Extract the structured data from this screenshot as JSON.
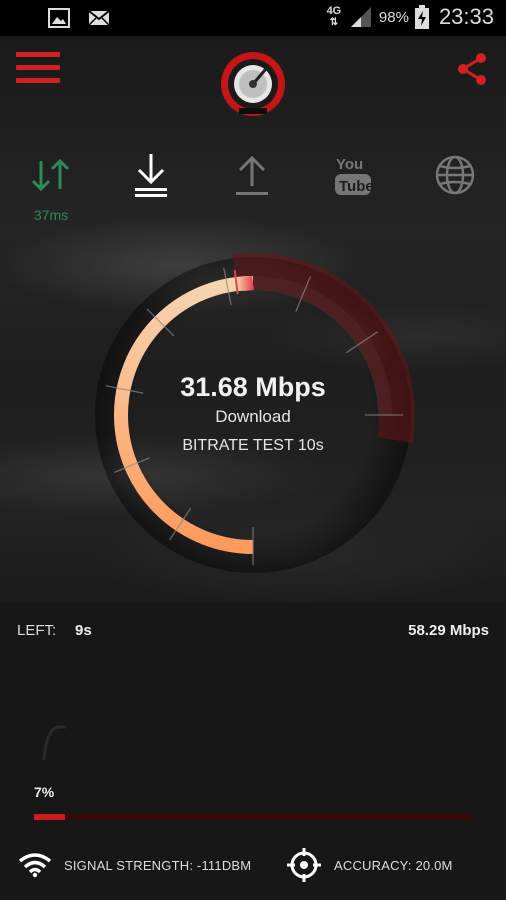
{
  "status_bar": {
    "network": "4G",
    "battery": "98%",
    "time": "23:33"
  },
  "tabs": [
    {
      "name": "ping",
      "icon": "ping-arrows-icon",
      "active": false,
      "color": "#2e8b57"
    },
    {
      "name": "download",
      "icon": "download-icon",
      "active": true,
      "color": "#ffffff"
    },
    {
      "name": "upload",
      "icon": "upload-icon",
      "active": false,
      "color": "#777777"
    },
    {
      "name": "youtube",
      "icon": "youtube-icon",
      "active": false,
      "color": "#777777"
    },
    {
      "name": "web",
      "icon": "globe-icon",
      "active": false,
      "color": "#777777"
    }
  ],
  "ping": {
    "value": "37ms"
  },
  "gauge": {
    "speed": "31.68 Mbps",
    "mode": "Download",
    "test": "BITRATE TEST 10s",
    "fill_fraction": 0.64
  },
  "stats": {
    "left_label": "LEFT:",
    "left_value": "9s",
    "max_speed": "58.29 Mbps"
  },
  "progress": {
    "label": "7%",
    "value": 0.07
  },
  "footer": {
    "signal": "SIGNAL STRENGTH: -111DBM",
    "accuracy": "ACCURACY: 20.0M"
  },
  "colors": {
    "accent": "#d32020",
    "gauge_start": "#ff9a5a",
    "gauge_mid": "#f7d4b0",
    "gauge_end": "#e4454a",
    "ping_green": "#2e8b57"
  }
}
